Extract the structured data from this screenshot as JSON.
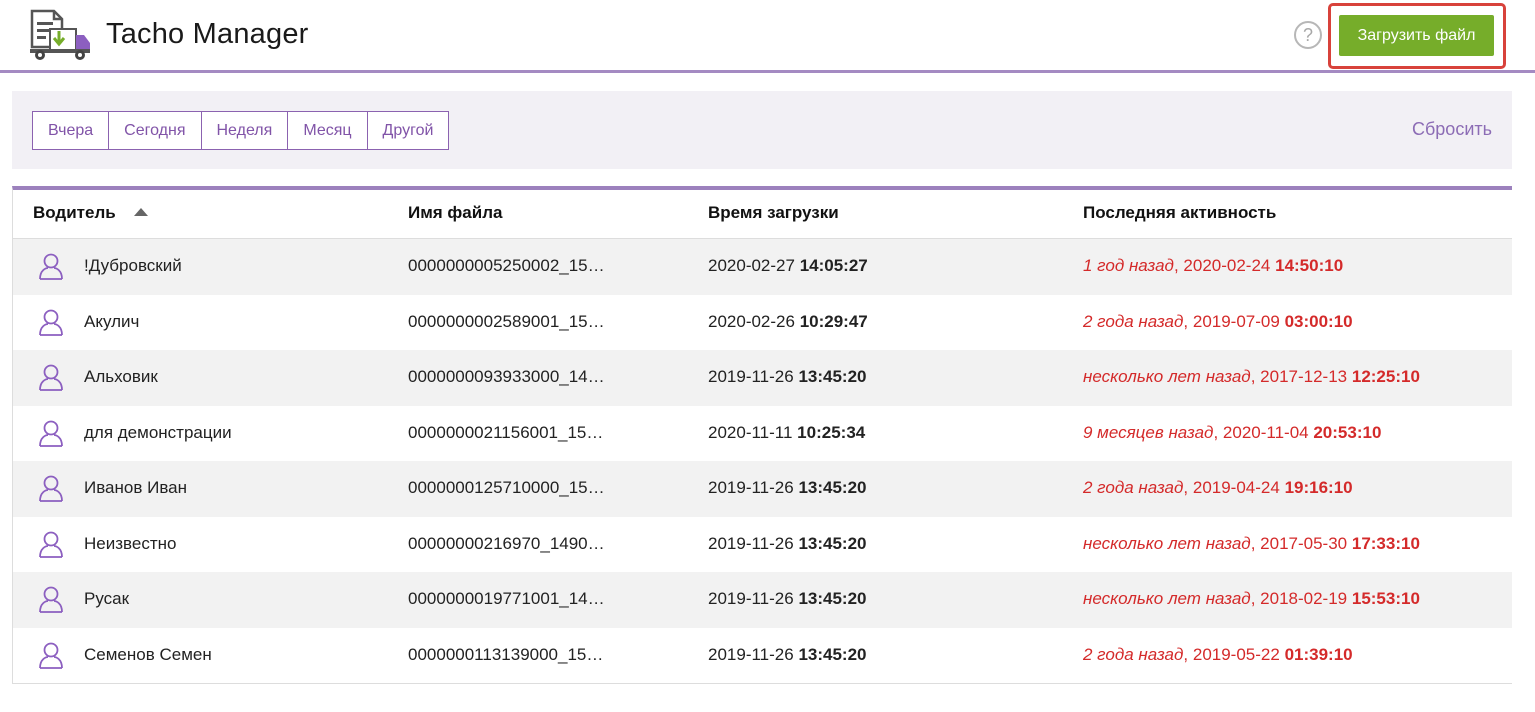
{
  "header": {
    "title": "Tacho Manager",
    "help_symbol": "?",
    "upload_label": "Загрузить файл"
  },
  "filters": {
    "periods": [
      "Вчера",
      "Сегодня",
      "Неделя",
      "Месяц",
      "Другой"
    ],
    "reset_label": "Сбросить"
  },
  "table": {
    "columns": {
      "driver": "Водитель",
      "file": "Имя файла",
      "upload_time": "Время загрузки",
      "last_activity": "Последняя активность"
    },
    "rows": [
      {
        "driver": "!Дубровский",
        "file": "0000000005250002_15…",
        "upload_date": "2020-02-27",
        "upload_time": "14:05:27",
        "act_ago": "1 год назад",
        "act_date": "2020-02-24",
        "act_time": "14:50:10"
      },
      {
        "driver": "Акулич",
        "file": "0000000002589001_15…",
        "upload_date": "2020-02-26",
        "upload_time": "10:29:47",
        "act_ago": "2 года назад",
        "act_date": "2019-07-09",
        "act_time": "03:00:10"
      },
      {
        "driver": "Альховик",
        "file": "0000000093933000_14…",
        "upload_date": "2019-11-26",
        "upload_time": "13:45:20",
        "act_ago": "несколько лет назад",
        "act_date": "2017-12-13",
        "act_time": "12:25:10"
      },
      {
        "driver": "для демонстрации",
        "file": "0000000021156001_15…",
        "upload_date": "2020-11-11",
        "upload_time": "10:25:34",
        "act_ago": "9 месяцев назад",
        "act_date": "2020-11-04",
        "act_time": "20:53:10"
      },
      {
        "driver": "Иванов Иван",
        "file": "0000000125710000_15…",
        "upload_date": "2019-11-26",
        "upload_time": "13:45:20",
        "act_ago": "2 года назад",
        "act_date": "2019-04-24",
        "act_time": "19:16:10"
      },
      {
        "driver": "Неизвестно",
        "file": "00000000216970_1490…",
        "upload_date": "2019-11-26",
        "upload_time": "13:45:20",
        "act_ago": "несколько лет назад",
        "act_date": "2017-05-30",
        "act_time": "17:33:10"
      },
      {
        "driver": "Русак",
        "file": "0000000019771001_14…",
        "upload_date": "2019-11-26",
        "upload_time": "13:45:20",
        "act_ago": "несколько лет назад",
        "act_date": "2018-02-19",
        "act_time": "15:53:10"
      },
      {
        "driver": "Семенов Семен",
        "file": "0000000113139000_15…",
        "upload_date": "2019-11-26",
        "upload_time": "13:45:20",
        "act_ago": "2 года назад",
        "act_date": "2019-05-22",
        "act_time": "01:39:10"
      }
    ]
  },
  "icons": {
    "logo": "truck-document-icon",
    "help": "question-circle-icon",
    "driver": "user-icon",
    "sort": "sort-ascending-icon"
  },
  "colors": {
    "accent_purple": "#8154a8",
    "upload_green": "#76ad2a",
    "highlight_red": "#d8423b",
    "activity_red": "#d42a2a"
  }
}
